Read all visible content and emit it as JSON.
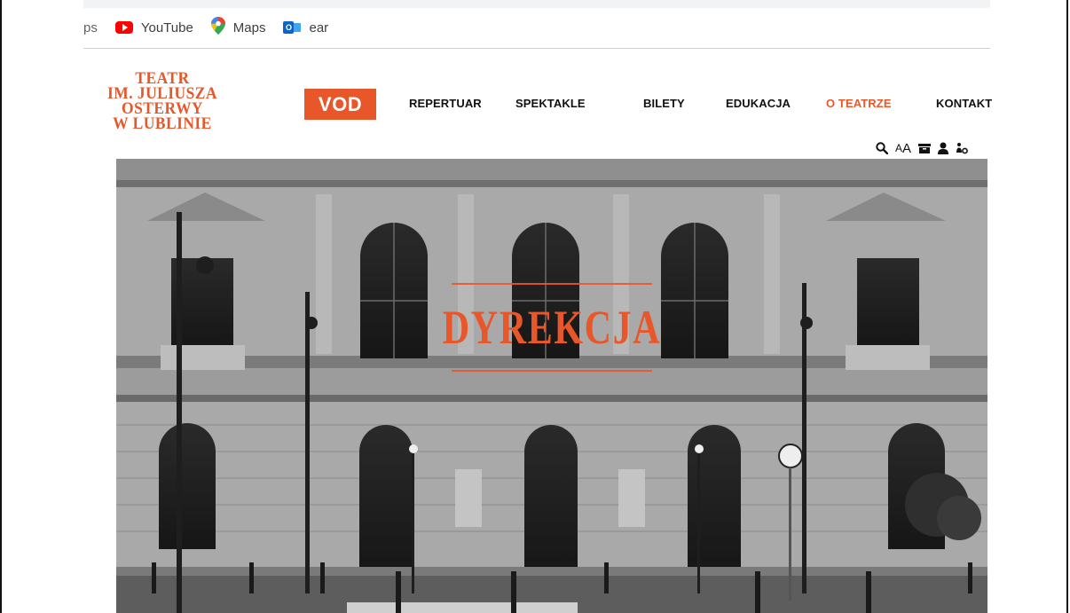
{
  "browser": {
    "url_fragment": "s",
    "bookmarks": [
      {
        "label": "ps",
        "icon": "apps-icon"
      },
      {
        "label": "YouTube",
        "icon": "youtube-icon"
      },
      {
        "label": "Maps",
        "icon": "maps-icon"
      },
      {
        "label": "ear",
        "icon": "outlook-icon"
      }
    ]
  },
  "site": {
    "logo_lines": [
      "TEATR",
      "IM. JULIUSZA",
      "OSTERWY",
      "W LUBLINIE"
    ],
    "vod_label": "VOD",
    "nav": [
      {
        "label": "REPERTUAR",
        "active": false
      },
      {
        "label": "SPEKTAKLE",
        "active": false
      },
      {
        "label": "BILETY",
        "active": false
      },
      {
        "label": "EDUKACJA",
        "active": false
      },
      {
        "label": "O TEATRZE",
        "active": true
      },
      {
        "label": "KONTAKT",
        "active": false
      }
    ],
    "tools": {
      "font_size_label_small": "A",
      "font_size_label_large": "A",
      "icons": [
        "search-icon",
        "font-size-icon",
        "ticket-icon",
        "user-icon",
        "accessibility-icon"
      ]
    },
    "accent_color": "#e8572a"
  },
  "hero": {
    "title": "DYREKCJA",
    "image": "theatre-building-facade-bw"
  }
}
